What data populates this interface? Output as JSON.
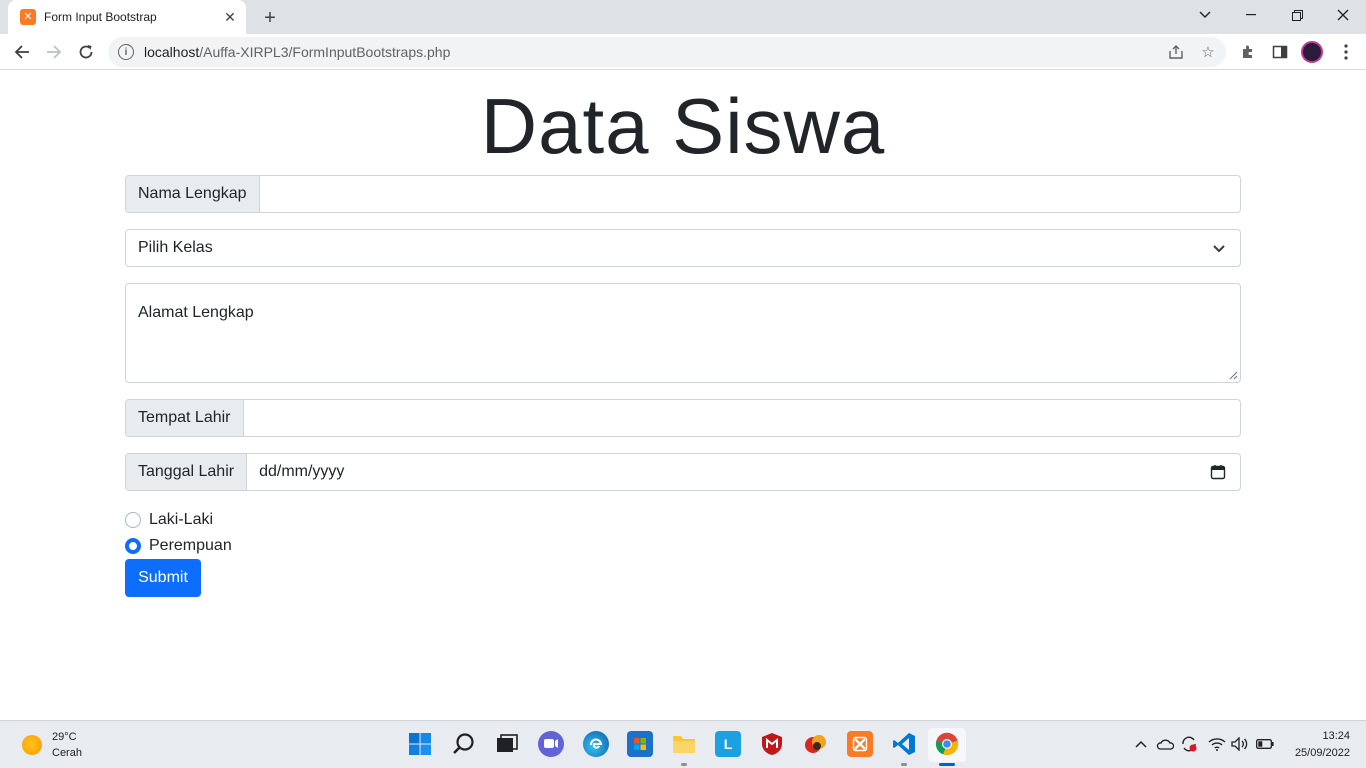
{
  "browser": {
    "tab_title": "Form Input Bootstrap",
    "url_host": "localhost",
    "url_path": "/Auffa-XIRPL3/FormInputBootstraps.php"
  },
  "page": {
    "title": "Data Siswa",
    "nama_label": "Nama Lengkap",
    "nama_value": "",
    "kelas_selected": "Pilih Kelas",
    "alamat_placeholder": "Alamat Lengkap",
    "tempat_label": "Tempat Lahir",
    "tempat_value": "",
    "tanggal_label": "Tanggal Lahir",
    "tanggal_placeholder": "dd/mm/yyyy",
    "gender_options": [
      "Laki-Laki",
      "Perempuan"
    ],
    "gender_selected": "Perempuan",
    "submit_label": "Submit"
  },
  "taskbar": {
    "temperature": "29°C",
    "weather": "Cerah",
    "time": "13:24",
    "date": "25/09/2022"
  },
  "colors": {
    "primary": "#0d6efd",
    "addon_bg": "#e9ecef",
    "border": "#ced4da"
  },
  "icons": {
    "taskbar_apps": [
      "windows-start-icon",
      "search-icon",
      "task-view-icon",
      "chat-icon",
      "edge-icon",
      "store-icon",
      "file-explorer-icon",
      "l-app-icon",
      "mcafee-icon",
      "game-icon",
      "xampp-icon",
      "vscode-icon",
      "chrome-icon"
    ]
  }
}
